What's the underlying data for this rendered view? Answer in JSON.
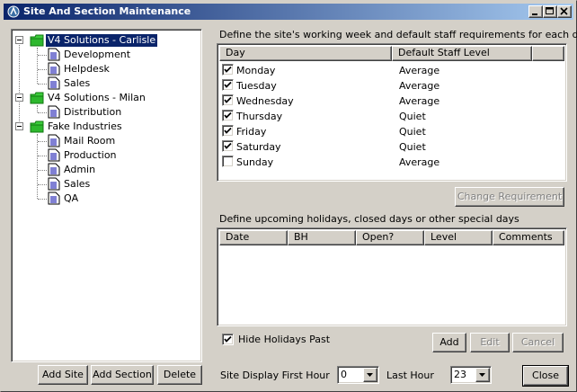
{
  "window": {
    "title": "Site And Section Maintenance"
  },
  "tree": [
    {
      "label": "V4 Solutions - Carlisle",
      "type": "site",
      "selected": true,
      "icon": "folder-icon"
    },
    {
      "label": "Development",
      "type": "section",
      "icon": "document-icon"
    },
    {
      "label": "Helpdesk",
      "type": "section",
      "icon": "document-icon"
    },
    {
      "label": "Sales",
      "type": "section",
      "icon": "document-icon"
    },
    {
      "label": "V4 Solutions - Milan",
      "type": "site",
      "icon": "folder-icon"
    },
    {
      "label": "Distribution",
      "type": "section",
      "icon": "document-icon"
    },
    {
      "label": "Fake Industries",
      "type": "site",
      "icon": "folder-icon"
    },
    {
      "label": "Mail Room",
      "type": "section",
      "icon": "document-icon"
    },
    {
      "label": "Production",
      "type": "section",
      "icon": "document-icon"
    },
    {
      "label": "Admin",
      "type": "section",
      "icon": "document-icon"
    },
    {
      "label": "Sales",
      "type": "section",
      "icon": "document-icon"
    },
    {
      "label": "QA",
      "type": "section",
      "icon": "document-icon"
    }
  ],
  "tree_buttons": {
    "add_site": "Add Site",
    "add_section": "Add Section",
    "delete": "Delete"
  },
  "week": {
    "label": "Define the site's working week and default staff requirements for each day",
    "columns": [
      "Day",
      "Default Staff Level"
    ],
    "rows": [
      {
        "day": "Monday",
        "checked": true,
        "level": "Average"
      },
      {
        "day": "Tuesday",
        "checked": true,
        "level": "Average"
      },
      {
        "day": "Wednesday",
        "checked": true,
        "level": "Average"
      },
      {
        "day": "Thursday",
        "checked": true,
        "level": "Quiet"
      },
      {
        "day": "Friday",
        "checked": true,
        "level": "Quiet"
      },
      {
        "day": "Saturday",
        "checked": true,
        "level": "Quiet"
      },
      {
        "day": "Sunday",
        "checked": false,
        "level": "Average"
      }
    ],
    "change_button": "Change Requirement"
  },
  "holidays": {
    "label": "Define upcoming holidays, closed days or other special days",
    "columns": [
      "Date",
      "BH",
      "Open?",
      "Level",
      "Comments"
    ],
    "hide_past_label": "Hide Holidays Past",
    "hide_past_checked": true,
    "add": "Add",
    "edit": "Edit",
    "cancel": "Cancel"
  },
  "footer": {
    "first_hour_label": "Site Display First Hour",
    "first_hour_value": "0",
    "last_hour_label": "Last Hour",
    "last_hour_value": "23",
    "close": "Close"
  },
  "colors": {
    "selection": "#0a246a",
    "titlebar_start": "#0a246a",
    "titlebar_end": "#a6caf0",
    "face": "#d4d0c8",
    "folder": "#22aa22"
  }
}
